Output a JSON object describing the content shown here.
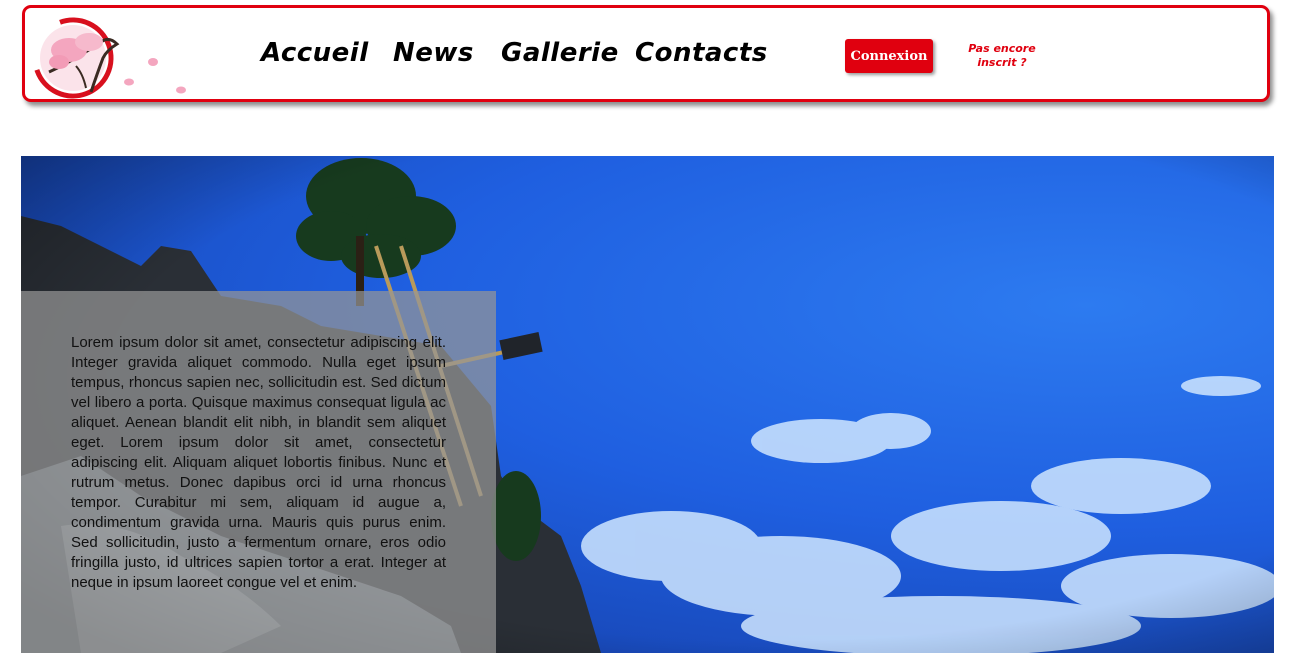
{
  "header": {
    "logo_name": "cherry-blossom-logo",
    "nav": [
      {
        "label": "Accueil"
      },
      {
        "label": "News"
      },
      {
        "label": "Gallerie"
      },
      {
        "label": "Contacts"
      }
    ],
    "login_label": "Connexion",
    "signup_label": "Pas encore inscrit ?"
  },
  "hero": {
    "image": "blue-sky-rock-tree-landscape",
    "body_text": "Lorem ipsum dolor sit amet, consectetur adipiscing elit. Integer gravida aliquet commodo. Nulla eget ipsum tempus, rhoncus sapien nec, sollicitudin est. Sed dictum vel libero a porta. Quisque maximus consequat ligula ac aliquet. Aenean blandit elit nibh, in blandit sem aliquet eget. Lorem ipsum dolor sit amet, consectetur adipiscing elit. Aliquam aliquet lobortis finibus. Nunc et rutrum metus. Donec dapibus orci id urna rhoncus tempor. Curabitur mi sem, aliquam id augue a, condimentum gravida urna. Mauris quis purus enim. Sed sollicitudin, justo a fermentum ornare, eros odio fringilla justo, id ultrices sapien tortor a erat. Integer at neque in ipsum laoreet congue vel et enim."
  },
  "colors": {
    "accent": "#e0000f",
    "sky": "#1f5fe0"
  }
}
